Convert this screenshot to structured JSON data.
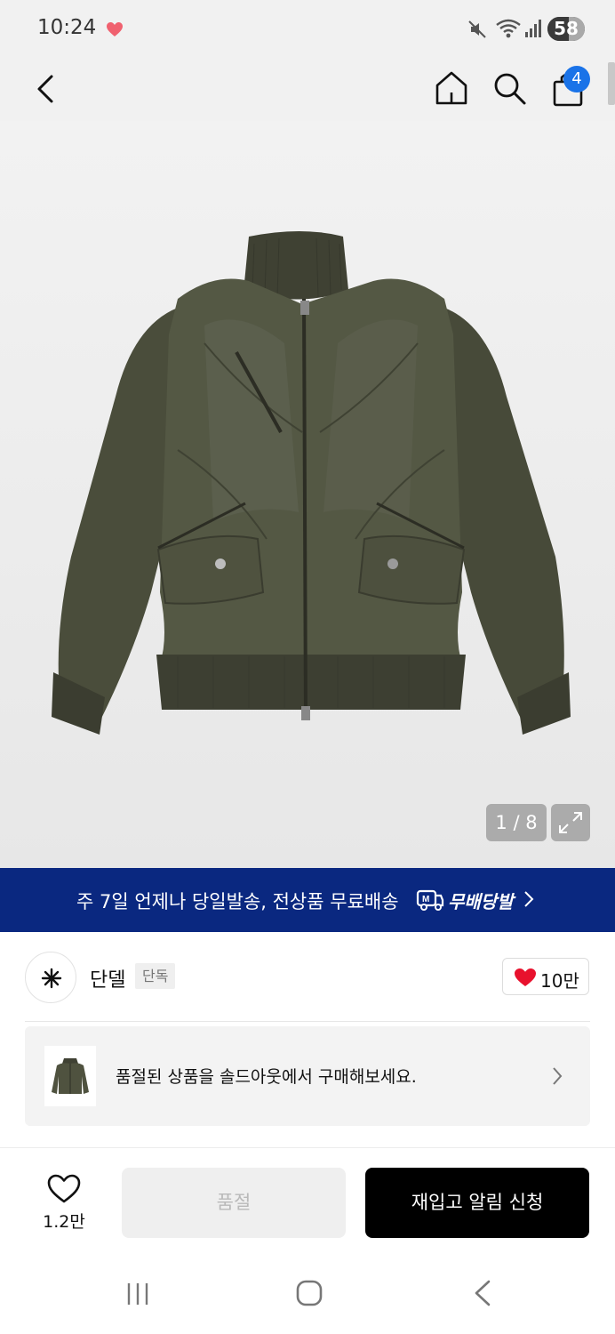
{
  "status_bar": {
    "time": "10:24",
    "battery": "58",
    "icons": [
      "heart-notification-icon",
      "mute-icon",
      "wifi-icon",
      "signal-icon",
      "battery-icon"
    ]
  },
  "nav": {
    "cart_badge": "4",
    "icons": [
      "back-icon",
      "home-icon",
      "search-icon",
      "shopping-bag-icon"
    ]
  },
  "product_image": {
    "counter": "1 / 8",
    "description_icon": "jacket-image"
  },
  "promo_banner": {
    "text": "주 7일 언제나 당일발송, 전상품 무료배송",
    "logo_text": "무배당발",
    "background": "#0a2880"
  },
  "brand": {
    "name": "단델",
    "tag": "단독",
    "likes": "10만"
  },
  "suggestion": {
    "text": "품절된 상품을 솔드아웃에서 구매해보세요."
  },
  "actions": {
    "wish_count": "1.2만",
    "soldout_label": "품절",
    "restock_label": "재입고 알림 신청"
  },
  "colors": {
    "accent_blue": "#1a73e8",
    "banner_navy": "#0a2880",
    "like_red": "#e8112d",
    "primary_button": "#000000"
  }
}
